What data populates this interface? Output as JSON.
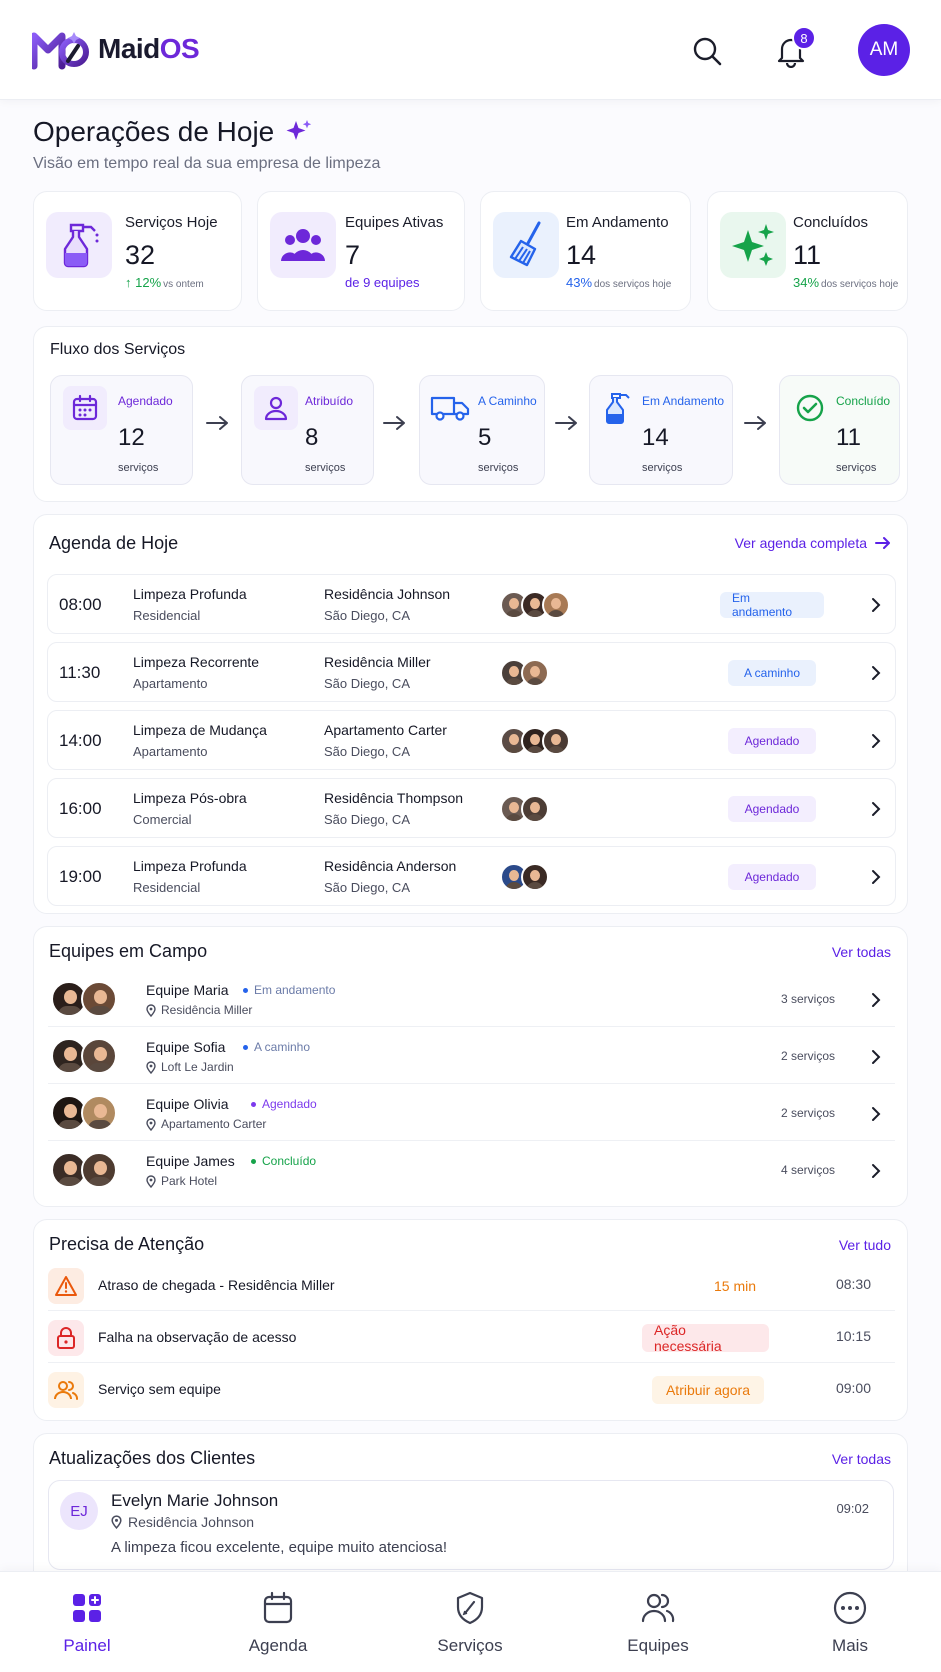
{
  "app": {
    "brand_prefix": "Maid",
    "brand_suffix": "OS",
    "user_initials": "AM",
    "notification_count": "8"
  },
  "page": {
    "title": "Operações de Hoje",
    "subtitle": "Visão em tempo real da sua empresa de limpeza"
  },
  "stats": [
    {
      "label": "Serviços Hoje",
      "value": "32",
      "sub_main": "12%",
      "sub_small": "vs ontem",
      "color": "#16a34a",
      "icon": "spray-bottle-icon"
    },
    {
      "label": "Equipes Ativas",
      "value": "7",
      "sub_main": "de 9 equipes",
      "sub_small": "",
      "color": "#5b21e6",
      "icon": "team-icon"
    },
    {
      "label": "Em Andamento",
      "value": "14",
      "sub_main": "43%",
      "sub_small": "dos serviços hoje",
      "color": "#2563eb",
      "icon": "broom-icon"
    },
    {
      "label": "Concluídos",
      "value": "11",
      "sub_main": "34%",
      "sub_small": "dos serviços hoje",
      "color": "#16a34a",
      "icon": "sparkles-icon"
    }
  ],
  "flow": {
    "title": "Fluxo dos Serviços",
    "steps": [
      {
        "label": "Agendado",
        "value": "12",
        "unit": "serviços",
        "color": "#6d28d9",
        "icon": "calendar-icon"
      },
      {
        "label": "Atribuído",
        "value": "8",
        "unit": "serviços",
        "color": "#6d28d9",
        "icon": "person-icon"
      },
      {
        "label": "A Caminho",
        "value": "5",
        "unit": "serviços",
        "color": "#2563eb",
        "icon": "truck-icon"
      },
      {
        "label": "Em Andamento",
        "value": "14",
        "unit": "serviços",
        "color": "#2563eb",
        "icon": "spray-bottle-icon"
      },
      {
        "label": "Concluído",
        "value": "11",
        "unit": "serviços",
        "color": "#16a34a",
        "icon": "check-circle-icon"
      }
    ]
  },
  "agenda": {
    "title": "Agenda de Hoje",
    "link": "Ver agenda completa",
    "rows": [
      {
        "time": "08:00",
        "service": "Limpeza Profunda",
        "type": "Residencial",
        "place": "Residência Johnson",
        "city": "São Diego, CA",
        "status": "Em andamento",
        "status_kind": "blue"
      },
      {
        "time": "11:30",
        "service": "Limpeza Recorrente",
        "type": "Apartamento",
        "place": "Residência Miller",
        "city": "São Diego, CA",
        "status": "A caminho",
        "status_kind": "blue"
      },
      {
        "time": "14:00",
        "service": "Limpeza de Mudança",
        "type": "Apartamento",
        "place": "Apartamento Carter",
        "city": "São Diego, CA",
        "status": "Agendado",
        "status_kind": "purple"
      },
      {
        "time": "16:00",
        "service": "Limpeza Pós-obra",
        "type": "Comercial",
        "place": "Residência Thompson",
        "city": "São Diego, CA",
        "status": "Agendado",
        "status_kind": "purple"
      },
      {
        "time": "19:00",
        "service": "Limpeza Profunda",
        "type": "Residencial",
        "place": "Residência Anderson",
        "city": "São Diego, CA",
        "status": "Agendado",
        "status_kind": "purple"
      }
    ]
  },
  "teams": {
    "title": "Equipes em Campo",
    "link": "Ver todas",
    "rows": [
      {
        "name": "Equipe Maria",
        "status": "Em andamento",
        "status_color": "#2563eb",
        "location": "Residência Miller",
        "count": "3 serviços"
      },
      {
        "name": "Equipe Sofia",
        "status": "A caminho",
        "status_color": "#2563eb",
        "location": "Loft Le Jardin",
        "count": "2 serviços"
      },
      {
        "name": "Equipe Olivia",
        "status": "Agendado",
        "status_color": "#7c3aed",
        "location": "Apartamento Carter",
        "count": "2 serviços"
      },
      {
        "name": "Equipe James",
        "status": "Concluído",
        "status_color": "#16a34a",
        "location": "Park Hotel",
        "count": "4 serviços"
      }
    ]
  },
  "attention": {
    "title": "Precisa de Atenção",
    "link": "Ver tudo",
    "rows": [
      {
        "text": "Atraso de chegada - Residência Miller",
        "tag": "15 min",
        "time": "08:30",
        "icon": "warning-icon"
      },
      {
        "text": "Falha na observação de acesso",
        "tag": "Ação necessária",
        "time": "10:15",
        "icon": "lock-icon"
      },
      {
        "text": "Serviço sem equipe",
        "tag": "Atribuir agora",
        "time": "09:00",
        "icon": "users-icon"
      }
    ]
  },
  "updates": {
    "title": "Atualizações dos Clientes",
    "link": "Ver todas",
    "item": {
      "initials": "EJ",
      "name": "Evelyn Marie Johnson",
      "location": "Residência Johnson",
      "message": "A limpeza ficou excelente, equipe muito atenciosa!",
      "time": "09:02"
    }
  },
  "nav": [
    {
      "label": "Painel",
      "icon": "dashboard-icon",
      "active": true
    },
    {
      "label": "Agenda",
      "icon": "calendar-icon",
      "active": false
    },
    {
      "label": "Serviços",
      "icon": "shield-icon",
      "active": false
    },
    {
      "label": "Equipes",
      "icon": "users-icon",
      "active": false
    },
    {
      "label": "Mais",
      "icon": "more-icon",
      "active": false
    }
  ],
  "colors": {
    "accent": "#5b21e6",
    "blue": "#2563eb",
    "green": "#16a34a",
    "orange": "#ea7a0c",
    "red": "#dc2626"
  }
}
